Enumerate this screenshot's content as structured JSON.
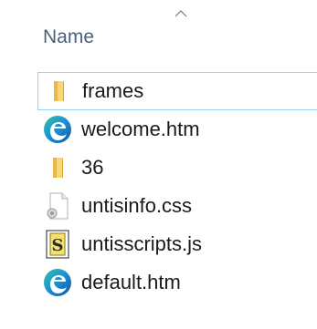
{
  "header": {
    "column_name": "Name",
    "sort_icon": "chevron-up-icon"
  },
  "files": [
    {
      "name": "frames",
      "icon": "folder-icon",
      "selected": true
    },
    {
      "name": "welcome.htm",
      "icon": "edge-html-icon",
      "selected": false
    },
    {
      "name": "36",
      "icon": "folder-icon",
      "selected": false
    },
    {
      "name": "untisinfo.css",
      "icon": "css-file-icon",
      "selected": false
    },
    {
      "name": "untisscripts.js",
      "icon": "js-script-icon",
      "selected": false
    },
    {
      "name": "default.htm",
      "icon": "edge-html-icon",
      "selected": false
    }
  ],
  "colors": {
    "folder": "#f8d775",
    "selection_border": "#99d1ff",
    "header_text": "#4c607a",
    "edge_blue": "#0c59a4",
    "edge_green": "#34c2a2"
  }
}
